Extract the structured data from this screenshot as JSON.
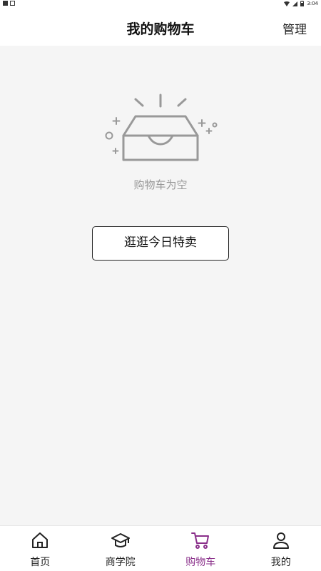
{
  "status_bar": {
    "time": "3:04"
  },
  "header": {
    "title": "我的购物车",
    "manage_label": "管理"
  },
  "empty_state": {
    "message": "购物车为空",
    "button_label": "逛逛今日特卖"
  },
  "tabbar": {
    "items": [
      {
        "label": "首页",
        "icon": "home-icon",
        "active": false
      },
      {
        "label": "商学院",
        "icon": "graduation-cap-icon",
        "active": false
      },
      {
        "label": "购物车",
        "icon": "cart-icon",
        "active": true
      },
      {
        "label": "我的",
        "icon": "user-icon",
        "active": false
      }
    ]
  },
  "colors": {
    "active": "#8a2f8a",
    "background": "#f5f5f5"
  }
}
